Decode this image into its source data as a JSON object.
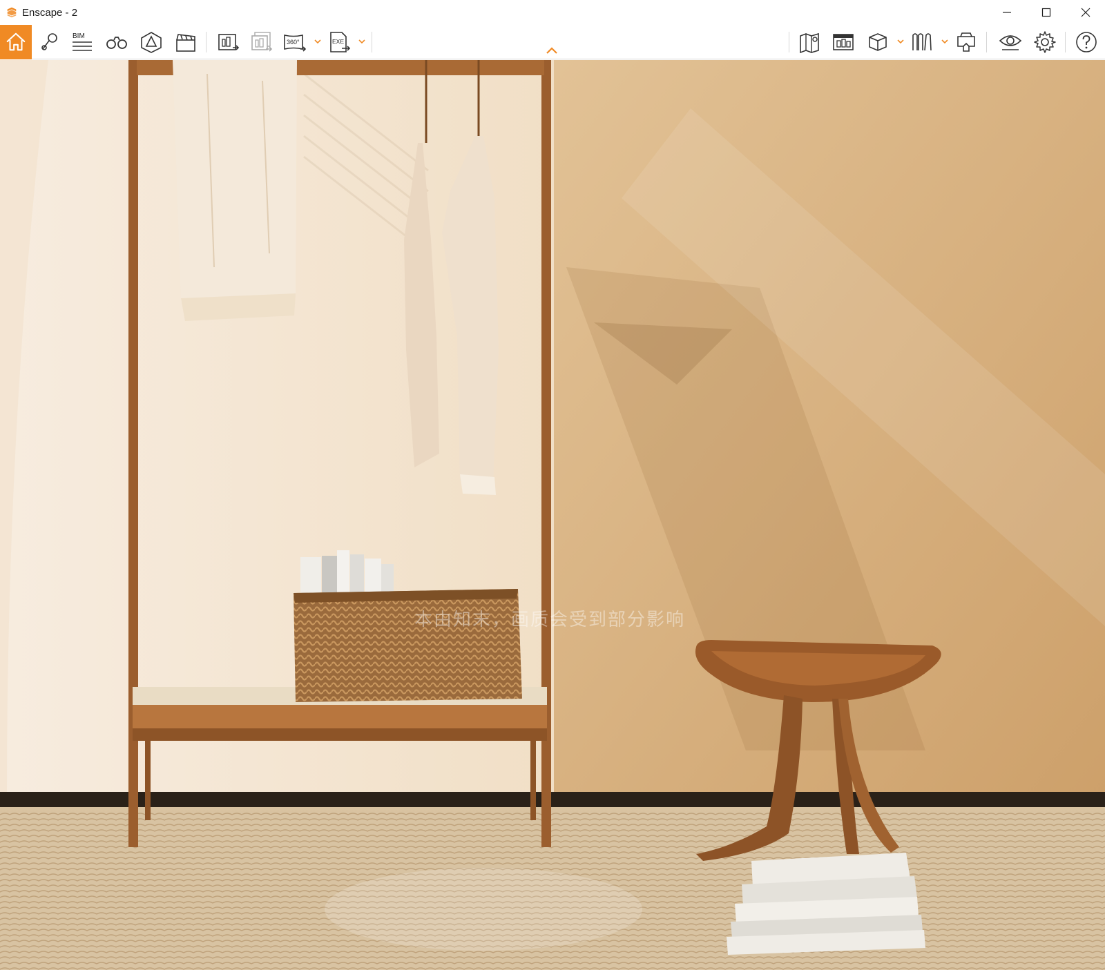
{
  "window": {
    "title": "Enscape - 2",
    "controls": [
      "minimize-icon",
      "maximize-icon",
      "close-icon"
    ]
  },
  "toolbar": {
    "accent_color": "#f08a24",
    "left_tools": [
      {
        "name": "home-icon",
        "active": true
      },
      {
        "name": "views-icon"
      },
      {
        "name": "bim-icon",
        "label": "BIM"
      },
      {
        "name": "binoculars-icon"
      },
      {
        "name": "asset-library-icon"
      },
      {
        "name": "video-editor-icon"
      },
      {
        "name": "render-image-icon"
      },
      {
        "name": "batch-render-icon"
      },
      {
        "name": "panorama-icon",
        "label": "360°"
      },
      {
        "name": "export-exe-icon",
        "label": "EXE"
      }
    ],
    "right_tools": [
      {
        "name": "map-icon"
      },
      {
        "name": "cinema-icon"
      },
      {
        "name": "cube-icon"
      },
      {
        "name": "bookmarks-icon"
      },
      {
        "name": "vr-headset-icon"
      },
      {
        "name": "visual-settings-icon"
      },
      {
        "name": "settings-icon"
      },
      {
        "name": "help-icon"
      }
    ]
  },
  "viewport": {
    "watermark": "本由知末，画质会受到部分影响"
  }
}
